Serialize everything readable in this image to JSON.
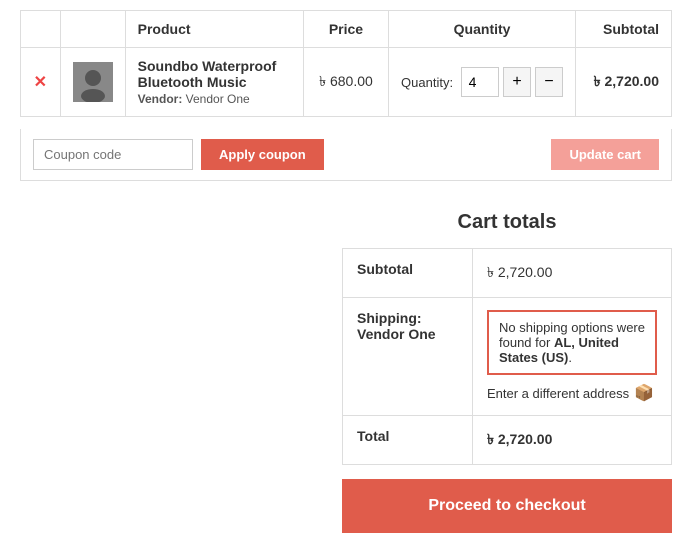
{
  "table": {
    "headers": {
      "remove": "",
      "thumbnail": "",
      "product": "Product",
      "price": "Price",
      "quantity": "Quantity",
      "subtotal": "Subtotal"
    },
    "rows": [
      {
        "product_name": "Soundbo Waterproof Bluetooth Music",
        "vendor_label": "Vendor:",
        "vendor_name": "Vendor One",
        "price": "৳ 680.00",
        "quantity_label": "Quantity:",
        "quantity": "4",
        "subtotal": "৳ 2,720.00"
      }
    ]
  },
  "coupon": {
    "input_placeholder": "Coupon code",
    "apply_label": "Apply coupon",
    "update_label": "Update cart"
  },
  "cart_totals": {
    "title": "Cart totals",
    "subtotal_label": "Subtotal",
    "subtotal_value": "৳ 2,720.00",
    "shipping_label": "Shipping:\nVendor One",
    "shipping_label_line1": "Shipping:",
    "shipping_label_line2": "Vendor One",
    "shipping_notice": "No shipping options were found for ",
    "shipping_location": "AL, United States (US)",
    "shipping_suffix": ".",
    "diff_address": "Enter a different address",
    "total_label": "Total",
    "total_value": "৳ 2,720.00",
    "proceed_label": "Proceed to checkout"
  },
  "colors": {
    "accent": "#e05c4b",
    "accent_light": "#f4a099",
    "border": "#ddd",
    "text": "#333",
    "muted": "#999"
  }
}
